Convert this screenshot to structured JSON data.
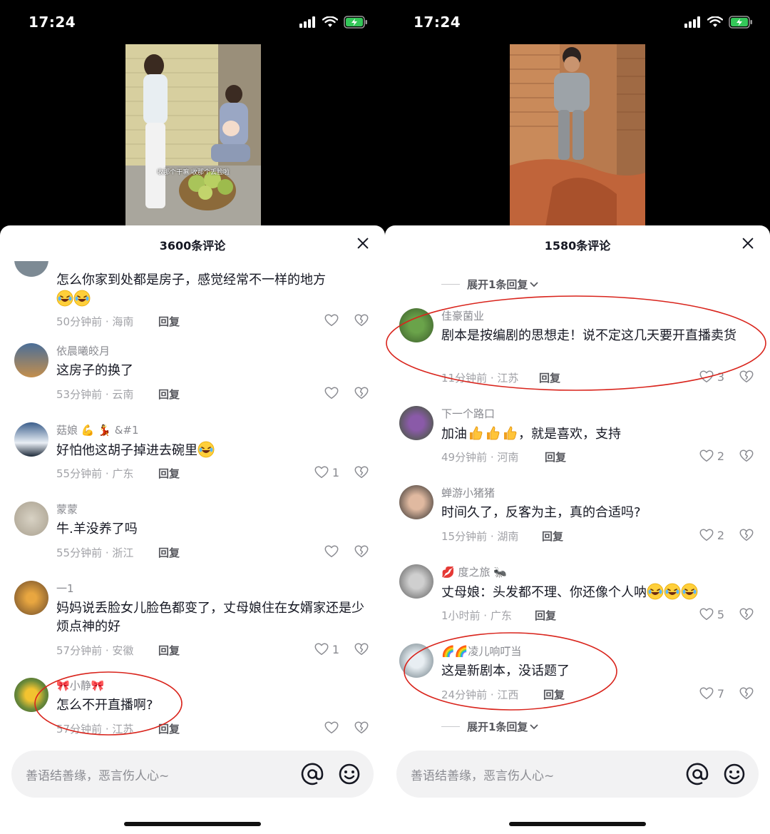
{
  "left": {
    "status": {
      "time": "17:24"
    },
    "video": {
      "subtitle": "收那个干嘛   收那个丢脸啦"
    },
    "sheet": {
      "title": "3600条评论"
    },
    "comments": [
      {
        "name": "",
        "text": "怎么你家到处都是房子，感觉经常不一样的地方",
        "meta": "50分钟前 · 海南",
        "reply": "回复",
        "likes": ""
      },
      {
        "name": "依晨曦皎月",
        "text": "这房子的换了",
        "meta": "53分钟前 · 云南",
        "reply": "回复",
        "likes": ""
      },
      {
        "name": "菇娘",
        "name_suffix": "&#1",
        "text": "好怕他这胡子掉进去碗里",
        "meta": "55分钟前 · 广东",
        "reply": "回复",
        "likes": "1"
      },
      {
        "name": "蒙蒙",
        "text": "牛.羊没养了吗",
        "meta": "55分钟前 · 浙江",
        "reply": "回复",
        "likes": ""
      },
      {
        "name": "一1",
        "text": "妈妈说丢脸女儿脸色都变了，丈母娘住在女婿家还是少烦点神的好",
        "meta": "57分钟前 · 安徽",
        "reply": "回复",
        "likes": "1"
      },
      {
        "name": "小静",
        "text": "怎么不开直播啊?",
        "meta": "57分钟前 · 江苏",
        "reply": "回复",
        "likes": ""
      }
    ],
    "input": {
      "placeholder": "善语结善缘，恶言伤人心~"
    }
  },
  "right": {
    "status": {
      "time": "17:24"
    },
    "sheet": {
      "title": "1580条评论"
    },
    "expand_top": "展开1条回复",
    "comments": [
      {
        "name": "佳豪菌业",
        "text": "剧本是按编剧的思想走！说不定这几天要开直播卖货",
        "meta": "11分钟前 · 江苏",
        "reply": "回复",
        "likes": "3"
      },
      {
        "name": "下一个路口",
        "text_a": "加油",
        "text_b": "，就是喜欢，支持",
        "meta": "49分钟前 · 河南",
        "reply": "回复",
        "likes": "2"
      },
      {
        "name": "蝉游小猪猪",
        "text": "时间久了，反客为主，真的合适吗?",
        "meta": "15分钟前 · 湖南",
        "reply": "回复",
        "likes": "2"
      },
      {
        "name": "度之旅",
        "text": "丈母娘：头发都不理、你还像个人呐",
        "meta": "1小时前 · 广东",
        "reply": "回复",
        "likes": "5"
      },
      {
        "name": "凌儿响叮当",
        "text": "这是新剧本，没话题了",
        "meta": "24分钟前 · 江西",
        "reply": "回复",
        "likes": "7"
      }
    ],
    "expand_bottom": "展开1条回复",
    "input": {
      "placeholder": "善语结善缘，恶言伤人心~"
    }
  },
  "colors": {
    "annotation": "#d9241c",
    "text": "#161823",
    "muted": "#8a8b91"
  },
  "icons": [
    "signal-icon",
    "wifi-icon",
    "battery-charging-icon",
    "close-icon",
    "heart-icon",
    "broken-heart-icon",
    "at-icon",
    "emoji-icon",
    "chevron-down-icon",
    "laughing-emoji-icon",
    "thumbs-up-emoji-icon"
  ]
}
